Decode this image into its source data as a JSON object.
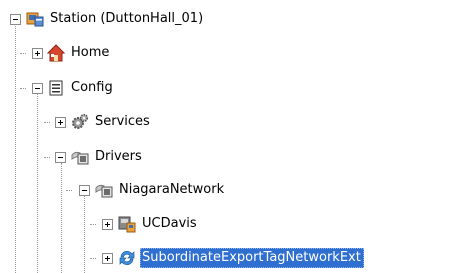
{
  "tree": {
    "station": {
      "label": "Station (DuttonHall_01)",
      "expander": "minus",
      "icon": "station-icon"
    },
    "home": {
      "label": "Home",
      "expander": "plus",
      "icon": "home-icon"
    },
    "config": {
      "label": "Config",
      "expander": "minus",
      "icon": "config-icon"
    },
    "services": {
      "label": "Services",
      "expander": "plus",
      "icon": "services-gear-icon"
    },
    "drivers": {
      "label": "Drivers",
      "expander": "minus",
      "icon": "drivers-icon"
    },
    "niagara_network": {
      "label": "NiagaraNetwork",
      "expander": "minus",
      "icon": "network-icon"
    },
    "ucdavis": {
      "label": "UCDavis",
      "expander": "plus",
      "icon": "station-device-icon"
    },
    "subordinate_export": {
      "label": "SubordinateExportTagNetworkExt",
      "expander": "plus",
      "icon": "sync-arrows-icon",
      "selected": true
    }
  },
  "colors": {
    "selection": "#2f6fd0",
    "tree_lines": "#9a9a9a"
  }
}
